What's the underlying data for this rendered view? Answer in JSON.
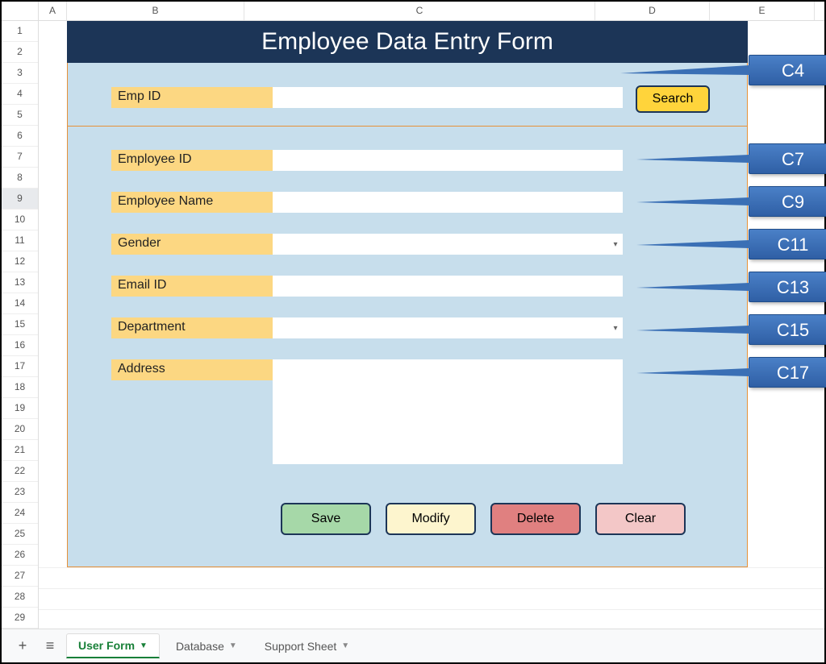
{
  "columns": [
    "A",
    "B",
    "C",
    "D",
    "E"
  ],
  "rows": [
    "1",
    "2",
    "3",
    "4",
    "5",
    "6",
    "7",
    "8",
    "9",
    "10",
    "11",
    "12",
    "13",
    "14",
    "15",
    "16",
    "17",
    "18",
    "19",
    "20",
    "21",
    "22",
    "23",
    "24",
    "25",
    "26",
    "27",
    "28",
    "29"
  ],
  "selected_row": "9",
  "title": "Employee Data Entry Form",
  "search": {
    "label": "Emp ID",
    "button": "Search"
  },
  "fields": {
    "emp_id": "Employee ID",
    "emp_name": "Employee Name",
    "gender": "Gender",
    "email": "Email ID",
    "department": "Department",
    "address": "Address"
  },
  "buttons": {
    "save": "Save",
    "modify": "Modify",
    "delete": "Delete",
    "clear": "Clear"
  },
  "callouts": {
    "c4": "C4",
    "c7": "C7",
    "c9": "C9",
    "c11": "C11",
    "c13": "C13",
    "c15": "C15",
    "c17": "C17"
  },
  "tabs": {
    "active": "User Form",
    "others": [
      "Database",
      "Support Sheet"
    ]
  }
}
